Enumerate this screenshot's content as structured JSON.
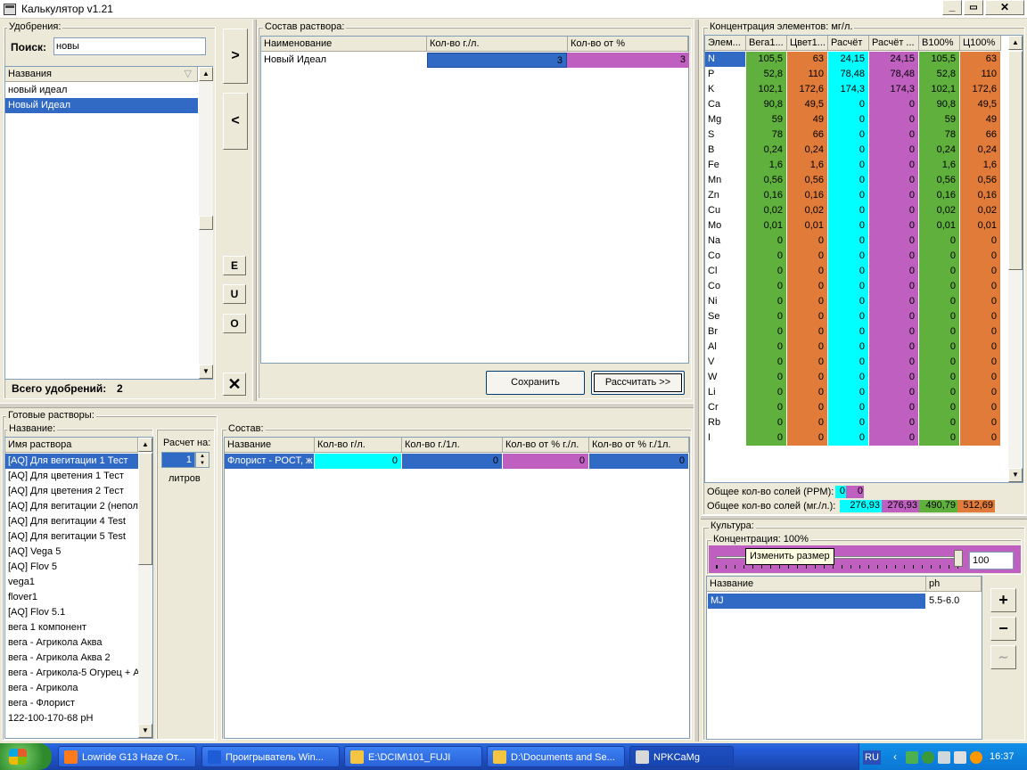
{
  "window": {
    "title": "Калькулятор v1.21"
  },
  "fertilizers": {
    "legend": "Удобрения:",
    "search_label": "Поиск:",
    "search_value": "новы",
    "list_header": "Названия",
    "items": [
      "новый идеал",
      "Новый Идеал"
    ],
    "selected_index": 1,
    "total_label": "Всего удобрений:",
    "total_count": "2"
  },
  "mid_buttons": {
    "add": ">",
    "remove": "<",
    "e": "E",
    "u": "U",
    "o": "O",
    "close": "✕"
  },
  "solution": {
    "legend": "Состав раствора:",
    "columns": [
      "Наименование",
      "Кол-во г./л.",
      "Кол-во от %"
    ],
    "rows": [
      {
        "name": "Новый Идеал",
        "qty": "3",
        "pct": "3"
      }
    ],
    "save_button": "Сохранить",
    "calc_button": "Рассчитать >>"
  },
  "concentration": {
    "legend": "Концентрация элементов: мг/л.",
    "columns": [
      "Элем...",
      "Вега1...",
      "Цвет1...",
      "Расчёт",
      "Расчёт ...",
      "В100%",
      "Ц100%"
    ],
    "rows": [
      [
        "N",
        "105,5",
        "63",
        "24,15",
        "24,15",
        "105,5",
        "63"
      ],
      [
        "P",
        "52,8",
        "110",
        "78,48",
        "78,48",
        "52,8",
        "110"
      ],
      [
        "K",
        "102,1",
        "172,6",
        "174,3",
        "174,3",
        "102,1",
        "172,6"
      ],
      [
        "Ca",
        "90,8",
        "49,5",
        "0",
        "0",
        "90,8",
        "49,5"
      ],
      [
        "Mg",
        "59",
        "49",
        "0",
        "0",
        "59",
        "49"
      ],
      [
        "S",
        "78",
        "66",
        "0",
        "0",
        "78",
        "66"
      ],
      [
        "B",
        "0,24",
        "0,24",
        "0",
        "0",
        "0,24",
        "0,24"
      ],
      [
        "Fe",
        "1,6",
        "1,6",
        "0",
        "0",
        "1,6",
        "1,6"
      ],
      [
        "Mn",
        "0,56",
        "0,56",
        "0",
        "0",
        "0,56",
        "0,56"
      ],
      [
        "Zn",
        "0,16",
        "0,16",
        "0",
        "0",
        "0,16",
        "0,16"
      ],
      [
        "Cu",
        "0,02",
        "0,02",
        "0",
        "0",
        "0,02",
        "0,02"
      ],
      [
        "Mo",
        "0,01",
        "0,01",
        "0",
        "0",
        "0,01",
        "0,01"
      ],
      [
        "Na",
        "0",
        "0",
        "0",
        "0",
        "0",
        "0"
      ],
      [
        "Co",
        "0",
        "0",
        "0",
        "0",
        "0",
        "0"
      ],
      [
        "Cl",
        "0",
        "0",
        "0",
        "0",
        "0",
        "0"
      ],
      [
        "Co",
        "0",
        "0",
        "0",
        "0",
        "0",
        "0"
      ],
      [
        "Ni",
        "0",
        "0",
        "0",
        "0",
        "0",
        "0"
      ],
      [
        "Se",
        "0",
        "0",
        "0",
        "0",
        "0",
        "0"
      ],
      [
        "Br",
        "0",
        "0",
        "0",
        "0",
        "0",
        "0"
      ],
      [
        "Al",
        "0",
        "0",
        "0",
        "0",
        "0",
        "0"
      ],
      [
        "V",
        "0",
        "0",
        "0",
        "0",
        "0",
        "0"
      ],
      [
        "W",
        "0",
        "0",
        "0",
        "0",
        "0",
        "0"
      ],
      [
        "Li",
        "0",
        "0",
        "0",
        "0",
        "0",
        "0"
      ],
      [
        "Cr",
        "0",
        "0",
        "0",
        "0",
        "0",
        "0"
      ],
      [
        "Rb",
        "0",
        "0",
        "0",
        "0",
        "0",
        "0"
      ],
      [
        "I",
        "0",
        "0",
        "0",
        "0",
        "0",
        "0"
      ]
    ],
    "col_colors": [
      "#ffffff",
      "#5fb03c",
      "#e07b39",
      "#00ffff",
      "#bf5fbf",
      "#5fb03c",
      "#e07b39"
    ],
    "ppm_label": "Общее кол-во солей (PPM):",
    "ppm_values": [
      "0",
      "0"
    ],
    "mg_label": "Общее кол-во солей (мг./л.):",
    "mg_values": [
      "276,93",
      "276,93",
      "490,79",
      "512,69"
    ]
  },
  "ready": {
    "legend": "Готовые растворы:",
    "name_legend": "Название:",
    "list_header": "Имя раствора",
    "items": [
      "[AQ] Для вегитации 1 Тест",
      "[AQ] Для цветения 1 Тест",
      "[AQ] Для цветения 2 Тест",
      "[AQ] Для вегитации 2 (непол",
      "[AQ] Для вегитации 4 Test",
      "[AQ] Для вегитации 5 Test",
      "[AQ] Vega 5",
      "[AQ] Flov 5",
      "vega1",
      "flover1",
      "[AQ] Flov 5.1",
      "вега 1 компонент",
      "вега - Агрикола Аква",
      "вега - Агрикола Аква 2",
      "вега - Агрикола-5 Огурец + А",
      "вега - Агрикола",
      "вега - Флорист",
      "122-100-170-68 pH"
    ],
    "selected_index": 0,
    "calc_label": "Расчет на:",
    "calc_value": "1",
    "liters_label": "литров"
  },
  "composition": {
    "legend": "Состав:",
    "columns": [
      "Название",
      "Кол-во г/л.",
      "Кол-во г./1л.",
      "Кол-во от % г./л.",
      "Кол-во от % г./1л."
    ],
    "rows": [
      {
        "name": "Флорист - РОСТ, ж",
        "v1": "0",
        "v2": "0",
        "v3": "0",
        "v4": "0"
      }
    ]
  },
  "culture": {
    "legend": "Культура:",
    "conc_legend": "Концентрация: 100%",
    "slider_value": "100",
    "slider_fraction": 1.0,
    "tooltip": "Изменить размер",
    "columns": [
      "Название",
      "ph"
    ],
    "rows": [
      {
        "name": "MJ",
        "ph": "5.5-6.0"
      }
    ],
    "add": "+",
    "remove": "−",
    "chart": "∼"
  },
  "taskbar": {
    "tasks": [
      "Lowride G13 Haze От...",
      "Проигрыватель Win...",
      "E:\\DCIM\\101_FUJI",
      "D:\\Documents and Se...",
      "NPKCaMg"
    ],
    "lang": "RU",
    "time": "16:37"
  }
}
